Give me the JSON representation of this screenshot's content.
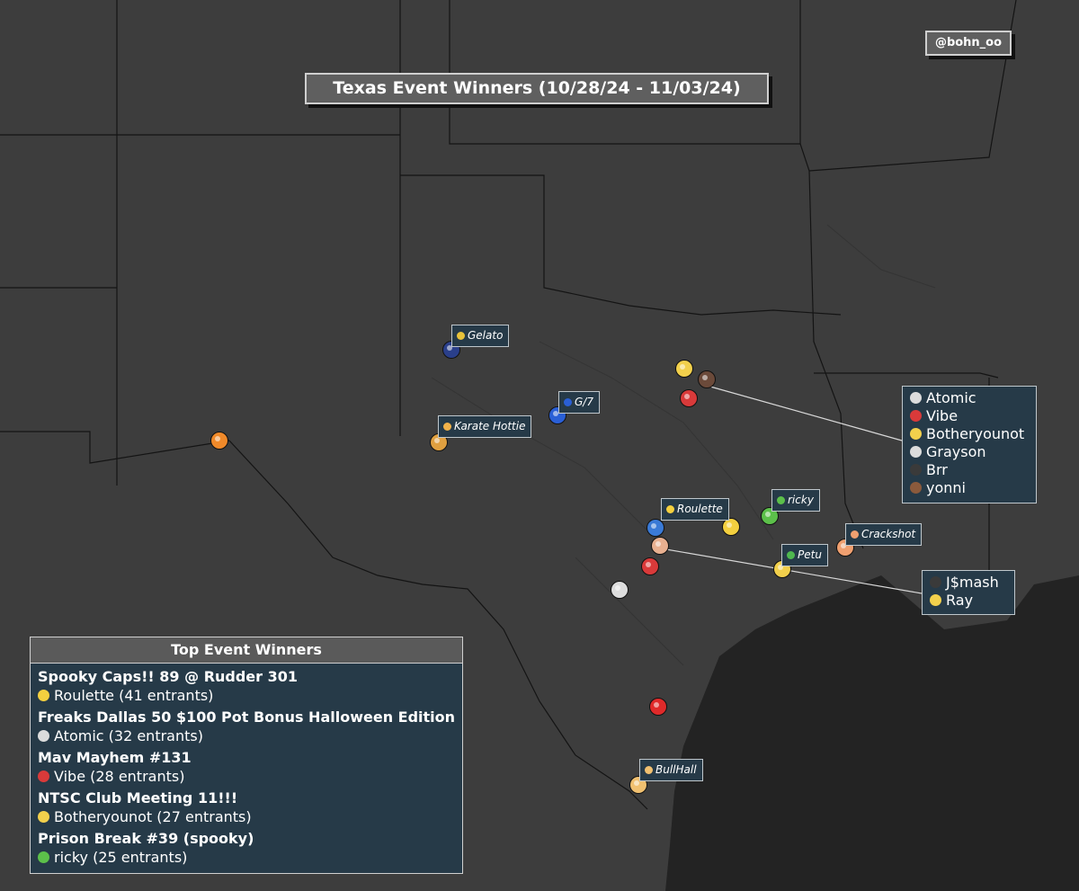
{
  "title": "Texas Event Winners (10/28/24 - 11/03/24)",
  "handle": "@bohn_oo",
  "colors": {
    "land": "#3d3d3d",
    "water": "#232323",
    "panel": "#263a48",
    "border": "#bfc7cc"
  },
  "labels": [
    {
      "name": "Gelato",
      "icon_color": "#e8c23a"
    },
    {
      "name": "G/7",
      "icon_color": "#2a5fd6"
    },
    {
      "name": "Karate Hottie",
      "icon_color": "#f0b24a"
    },
    {
      "name": "Roulette",
      "icon_color": "#f4d03f"
    },
    {
      "name": "ricky",
      "icon_color": "#5cc04a"
    },
    {
      "name": "Crackshot",
      "icon_color": "#f0a070"
    },
    {
      "name": "Petu",
      "icon_color": "#4fb84f"
    },
    {
      "name": "BullHall",
      "icon_color": "#f0c070"
    }
  ],
  "dfw_cluster": [
    {
      "name": "Atomic",
      "icon_color": "#dcdcdc"
    },
    {
      "name": "Vibe",
      "icon_color": "#d93a3a"
    },
    {
      "name": "Botheryounot",
      "icon_color": "#f2d04c"
    },
    {
      "name": "Grayson",
      "icon_color": "#dcdcdc"
    },
    {
      "name": "Brr",
      "icon_color": "#3a3a3a"
    },
    {
      "name": "yonni",
      "icon_color": "#8b5a3c"
    }
  ],
  "austin_cluster": [
    {
      "name": "J$mash",
      "icon_color": "#3a3a3a"
    },
    {
      "name": "Ray",
      "icon_color": "#f2d04c"
    }
  ],
  "top_events": {
    "heading": "Top Event Winners",
    "items": [
      {
        "event": "Spooky Caps!! 89 @ Rudder 301",
        "winner": "Roulette (41 entrants)",
        "icon_color": "#f4d03f"
      },
      {
        "event": "Freaks Dallas 50 $100 Pot Bonus Halloween Edition",
        "winner": "Atomic (32 entrants)",
        "icon_color": "#dcdcdc"
      },
      {
        "event": "Mav Mayhem #131",
        "winner": "Vibe (28 entrants)",
        "icon_color": "#d93a3a"
      },
      {
        "event": "NTSC Club Meeting 11!!!",
        "winner": "Botheryounot (27 entrants)",
        "icon_color": "#f2d04c"
      },
      {
        "event": "Prison Break #39 (spooky)",
        "winner": "ricky (25 entrants)",
        "icon_color": "#5cc04a"
      }
    ]
  },
  "markers": [
    {
      "name": "el-paso-marker",
      "color": "#f08a2a"
    },
    {
      "name": "gelato-marker",
      "color": "#2a3f8a"
    },
    {
      "name": "g7-marker",
      "color": "#2a5fd6"
    },
    {
      "name": "karate-hottie-marker",
      "color": "#e0a040"
    },
    {
      "name": "dfw-marker-1",
      "color": "#f2d04c"
    },
    {
      "name": "dfw-marker-2",
      "color": "#6b4a3a"
    },
    {
      "name": "dfw-marker-3",
      "color": "#d93a3a"
    },
    {
      "name": "roulette-marker",
      "color": "#f4d03f"
    },
    {
      "name": "ricky-marker",
      "color": "#5cc04a"
    },
    {
      "name": "crackshot-marker",
      "color": "#f0a070"
    },
    {
      "name": "austin-marker-1",
      "color": "#3a7ad6"
    },
    {
      "name": "austin-marker-2",
      "color": "#e8b090"
    },
    {
      "name": "austin-marker-3",
      "color": "#d93a3a"
    },
    {
      "name": "petu-marker",
      "color": "#f2d04c"
    },
    {
      "name": "san-antonio-marker",
      "color": "#dddddd"
    },
    {
      "name": "corpus-marker",
      "color": "#e02a2a"
    },
    {
      "name": "bullhall-marker",
      "color": "#f0c070"
    }
  ]
}
